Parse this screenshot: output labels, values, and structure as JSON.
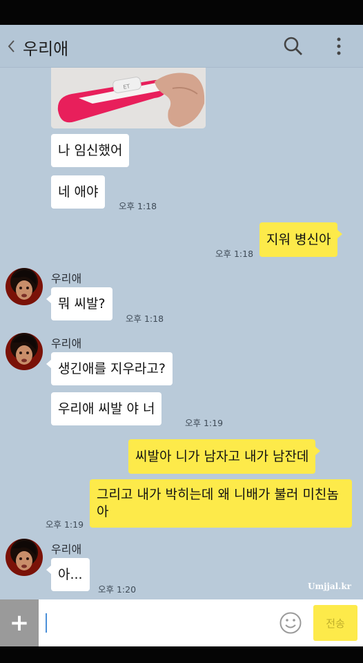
{
  "header": {
    "title": "우리애",
    "back_icon": "chevron-left-icon",
    "search_icon": "search-icon",
    "more_icon": "more-vertical-icon"
  },
  "colors": {
    "background": "#b9cad9",
    "my_bubble": "#fdea4a",
    "their_bubble": "#ffffff",
    "plus_button": "#9a9a9a"
  },
  "messages": [
    {
      "text": "나 임신했어"
    },
    {
      "text": "네 애야",
      "time": "오후 1:18"
    },
    {
      "text": "지워 병신아",
      "time": "오후 1:18"
    },
    {
      "sender": "우리애",
      "text": "뭐 씨발?",
      "time": "오후 1:18"
    },
    {
      "sender": "우리애",
      "text": "생긴애를 지우라고?"
    },
    {
      "text": "우리애 씨발 야 너",
      "time": "오후 1:19"
    },
    {
      "text": "씨발아 니가 남자고 내가 남잔데"
    },
    {
      "text": "그리고 내가 박히는데 왜 니배가 불러 미친놈아",
      "time": "오후 1:19"
    },
    {
      "sender": "우리애",
      "text": "아...",
      "time": "오후 1:20"
    }
  ],
  "watermark": "Umjjal.kr",
  "input": {
    "plus_label": "+",
    "value": "",
    "send_label": "전송",
    "emoji_icon": "emoji-smile-icon"
  }
}
